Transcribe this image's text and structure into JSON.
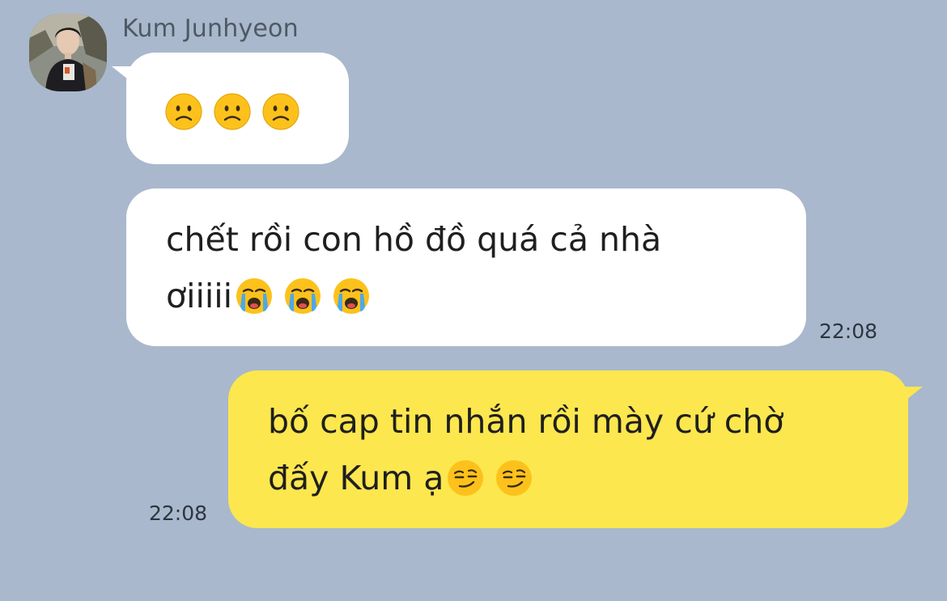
{
  "contact": {
    "name": "Kum Junhyeon",
    "avatar_icon": "profile-photo"
  },
  "messages": [
    {
      "direction": "incoming",
      "lines": [
        ""
      ],
      "emojis": [
        "slightly-frowning-face",
        "slightly-frowning-face",
        "slightly-frowning-face"
      ]
    },
    {
      "direction": "incoming",
      "line1": "chết rồi con hồ đồ quá cả nhà",
      "line2": "ơiiiii",
      "emojis": [
        "loudly-crying-face",
        "loudly-crying-face",
        "loudly-crying-face"
      ],
      "time": "22:08"
    },
    {
      "direction": "outgoing",
      "line1": "bố cap tin nhắn rồi mày cứ chờ",
      "line2": "đấy Kum ạ",
      "emojis": [
        "smirking-face",
        "smirking-face"
      ],
      "time": "22:08"
    }
  ],
  "colors": {
    "background": "#a9b8cc",
    "incoming_bubble": "#ffffff",
    "outgoing_bubble": "#fde74e"
  }
}
